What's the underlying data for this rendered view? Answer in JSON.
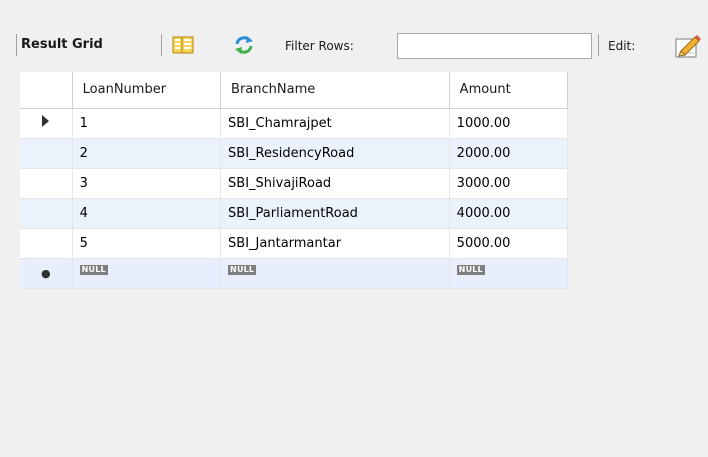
{
  "toolbar": {
    "result_grid_label": "Result Grid",
    "filter_label": "Filter Rows:",
    "filter_value": "",
    "edit_label": "Edit:"
  },
  "grid": {
    "columns": [
      "LoanNumber",
      "BranchName",
      "Amount"
    ],
    "rows": [
      {
        "loan": "1",
        "branch": "SBI_Chamrajpet",
        "amount": "1000.00"
      },
      {
        "loan": "2",
        "branch": "SBI_ResidencyRoad",
        "amount": "2000.00"
      },
      {
        "loan": "3",
        "branch": "SBI_ShivajiRoad",
        "amount": "3000.00"
      },
      {
        "loan": "4",
        "branch": "SBI_ParliamentRoad",
        "amount": "4000.00"
      },
      {
        "loan": "5",
        "branch": "SBI_Jantarmantar",
        "amount": "5000.00"
      }
    ],
    "null_label": "NULL"
  },
  "icons": {
    "form": "form-editor-icon",
    "refresh": "refresh-icon",
    "edit": "edit-pencil-icon"
  }
}
